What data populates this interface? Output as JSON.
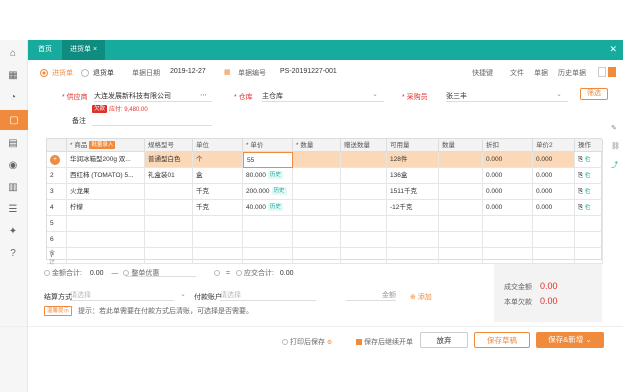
{
  "tabs": [
    {
      "label": "首页"
    },
    {
      "label": "进货单 ×"
    }
  ],
  "doc_type": {
    "purchase": "进货单",
    "return": "退货单"
  },
  "header": {
    "date_label": "单据日期",
    "date_value": "2019-12-27",
    "no_label": "单据编号",
    "no_value": "PS-20191227-001",
    "actions": [
      "快捷键",
      "文件",
      "单据",
      "历史单据"
    ]
  },
  "form": {
    "supplier_label": "* 供应商",
    "supplier_value": "大连发展新科技有限公司",
    "supplier_tag": "欠款",
    "supplier_note": "应付: 9,480.00",
    "warehouse_label": "* 仓库",
    "warehouse_value": "主仓库",
    "salesman_label": "* 采购员",
    "salesman_value": "张三丰",
    "more_label": "筛选",
    "remark_label": "备注"
  },
  "table": {
    "headers": [
      "",
      "* 商品",
      "规格型号",
      "单位",
      "* 单价",
      "* 数量",
      "赠送数量",
      "可用量",
      "数量",
      "折扣",
      "单价2",
      "操作"
    ],
    "add_label": "批量录入",
    "rows": [
      {
        "no": "1",
        "name": "华润冰箱型200g 双...",
        "spec": "普通型白色",
        "unit": "个",
        "price": "55",
        "qty": "",
        "avail": "128件",
        "disc": "0.000",
        "p2": "0.000",
        "tag": ""
      },
      {
        "no": "2",
        "name": "西红柿 (TOMATO) 5...",
        "spec": "礼盒装01",
        "unit": "盒",
        "price": "80.000",
        "qty": "",
        "avail": "136盒",
        "disc": "0.000",
        "p2": "0.000",
        "tag": "历史"
      },
      {
        "no": "3",
        "name": "火龙果",
        "spec": "",
        "unit": "千克",
        "price": "200.000",
        "qty": "",
        "avail": "1511千克",
        "disc": "0.000",
        "p2": "0.000",
        "tag": "历史"
      },
      {
        "no": "4",
        "name": "柠檬",
        "spec": "",
        "unit": "千克",
        "price": "40.000",
        "qty": "",
        "avail": "-12千克",
        "disc": "0.000",
        "p2": "0.000",
        "tag": "历史"
      },
      {
        "no": "5"
      },
      {
        "no": "6"
      },
      {
        "no": "7"
      }
    ],
    "sum_label": "合计"
  },
  "totals": {
    "amount_label": "金额合计:",
    "amount_value": "0.00",
    "discount_label": "整单优惠",
    "paid_label": "应交合计:",
    "paid_value": "0.00",
    "deal_label": "成交金额",
    "deal_value": "0.00",
    "due_label": "本单欠款",
    "due_value": "0.00"
  },
  "bottom": {
    "pay_label": "结算方式",
    "pay_placeholder": "请选择",
    "account_label": "付款账户",
    "account_placeholder": "请选择",
    "amount_label": "金额",
    "add_label": "添加",
    "hint_tag": "温馨提示",
    "hint": "提示：若此单需要在付款方式后清账，可选择是否需要。"
  },
  "footer": {
    "print_label": "打印后保存",
    "continue_label": "保存后继续开单",
    "cancel": "放弃",
    "save_draft": "保存草稿",
    "save_new": "保存&新增"
  },
  "colors": {
    "accent": "#16ab9c",
    "orange": "#f08a3c",
    "red": "#e0302a"
  }
}
